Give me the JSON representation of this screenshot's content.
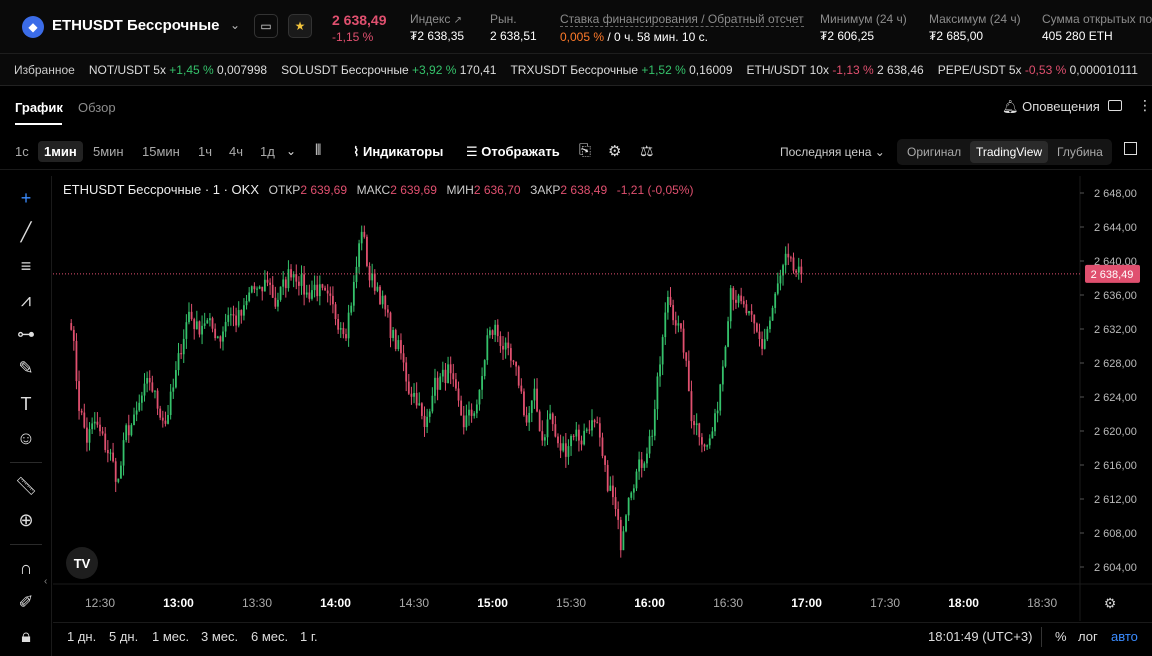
{
  "header": {
    "pair": "ETHUSDT Бессрочные",
    "last_price": "2 638,49",
    "change_pct": "-1,15 %",
    "stats": [
      {
        "label": "Индекс",
        "value": "₮2 638,35"
      },
      {
        "label": "Рын.",
        "value": "2 638,51"
      },
      {
        "label": "Ставка финансирования / Обратный отсчет",
        "value_rate": "0,005 %",
        "value_time": "/ 0 ч. 58 мин. 10 с."
      },
      {
        "label": "Минимум (24 ч)",
        "value": "₮2 606,25"
      },
      {
        "label": "Максимум (24 ч)",
        "value": "₮2 685,00"
      },
      {
        "label": "Сумма открытых поз",
        "value": "405 280 ETH"
      }
    ]
  },
  "favorites": {
    "label": "Избранное",
    "items": [
      {
        "name": "NOT/USDT 5x",
        "change": "+1,45 %",
        "price": "0,007998",
        "dir": "up"
      },
      {
        "name": "SOLUSDT Бессрочные",
        "change": "+3,92 %",
        "price": "170,41",
        "dir": "up"
      },
      {
        "name": "TRXUSDT Бессрочные",
        "change": "+1,52 %",
        "price": "0,16009",
        "dir": "up"
      },
      {
        "name": "ETH/USDT 10x",
        "change": "-1,13 %",
        "price": "2 638,46",
        "dir": "down"
      },
      {
        "name": "PEPE/USDT 5x",
        "change": "-0,53 %",
        "price": "0,000010111",
        "dir": "down"
      }
    ]
  },
  "tabs": {
    "chart": "График",
    "overview": "Обзор",
    "alerts": "Оповещения"
  },
  "toolbar": {
    "timeframes": [
      "1с",
      "1мин",
      "5мин",
      "15мин",
      "1ч",
      "4ч",
      "1д"
    ],
    "indicators": "Индикаторы",
    "display": "Отображать",
    "price_source": "Последняя цена",
    "views": [
      "Оригинал",
      "TradingView",
      "Глубина"
    ]
  },
  "legend": {
    "title": "ETHUSDT Бессрочные · 1 · OKX",
    "open_label": "ОТКР",
    "open": "2 639,69",
    "high_label": "МАКС",
    "high": "2 639,69",
    "low_label": "МИН",
    "low": "2 636,70",
    "close_label": "ЗАКР",
    "close": "2 638,49",
    "change": "-1,21 (-0,05%)"
  },
  "chart_data": {
    "type": "candlestick",
    "ylim": [
      2602,
      2650
    ],
    "y_ticks": [
      "2 648,00",
      "2 644,00",
      "2 640,00",
      "2 636,00",
      "2 632,00",
      "2 628,00",
      "2 624,00",
      "2 620,00",
      "2 616,00",
      "2 612,00",
      "2 608,00",
      "2 604,00"
    ],
    "y_tick_values": [
      2648,
      2644,
      2640,
      2636,
      2632,
      2628,
      2624,
      2620,
      2616,
      2612,
      2608,
      2604
    ],
    "x_ticks": [
      {
        "label": "12:30",
        "bold": false,
        "t": 0
      },
      {
        "label": "13:00",
        "bold": true,
        "t": 30
      },
      {
        "label": "13:30",
        "bold": false,
        "t": 60
      },
      {
        "label": "14:00",
        "bold": true,
        "t": 90
      },
      {
        "label": "14:30",
        "bold": false,
        "t": 120
      },
      {
        "label": "15:00",
        "bold": true,
        "t": 150
      },
      {
        "label": "15:30",
        "bold": false,
        "t": 180
      },
      {
        "label": "16:00",
        "bold": true,
        "t": 210
      },
      {
        "label": "16:30",
        "bold": false,
        "t": 240
      },
      {
        "label": "17:00",
        "bold": true,
        "t": 270
      },
      {
        "label": "17:30",
        "bold": false,
        "t": 300
      },
      {
        "label": "18:00",
        "bold": true,
        "t": 330
      },
      {
        "label": "18:30",
        "bold": false,
        "t": 360
      }
    ],
    "last_price": 2638.49,
    "last_price_label": "2 638,49",
    "waypoints": [
      [
        -11,
        2633
      ],
      [
        -8,
        2623
      ],
      [
        -5,
        2619
      ],
      [
        -2,
        2621
      ],
      [
        1,
        2619
      ],
      [
        4,
        2617
      ],
      [
        7,
        2614
      ],
      [
        10,
        2620
      ],
      [
        13,
        2621
      ],
      [
        16,
        2624
      ],
      [
        19,
        2626
      ],
      [
        22,
        2623
      ],
      [
        25,
        2621
      ],
      [
        28,
        2625
      ],
      [
        31,
        2630
      ],
      [
        34,
        2634
      ],
      [
        37,
        2632
      ],
      [
        40,
        2633
      ],
      [
        43,
        2632
      ],
      [
        46,
        2631
      ],
      [
        49,
        2634
      ],
      [
        52,
        2633
      ],
      [
        55,
        2634
      ],
      [
        58,
        2637
      ],
      [
        61,
        2636
      ],
      [
        64,
        2638
      ],
      [
        67,
        2635
      ],
      [
        70,
        2637
      ],
      [
        73,
        2639
      ],
      [
        76,
        2638
      ],
      [
        79,
        2636
      ],
      [
        82,
        2637
      ],
      [
        85,
        2636
      ],
      [
        88,
        2635
      ],
      [
        91,
        2633
      ],
      [
        94,
        2632
      ],
      [
        97,
        2637
      ],
      [
        100,
        2644
      ],
      [
        103,
        2638
      ],
      [
        106,
        2637
      ],
      [
        109,
        2634
      ],
      [
        112,
        2631
      ],
      [
        115,
        2629
      ],
      [
        118,
        2625
      ],
      [
        121,
        2624
      ],
      [
        124,
        2620
      ],
      [
        127,
        2625
      ],
      [
        130,
        2626
      ],
      [
        133,
        2627
      ],
      [
        136,
        2624
      ],
      [
        139,
        2621
      ],
      [
        142,
        2622
      ],
      [
        145,
        2624
      ],
      [
        148,
        2631
      ],
      [
        151,
        2632
      ],
      [
        154,
        2630
      ],
      [
        157,
        2628
      ],
      [
        160,
        2626
      ],
      [
        163,
        2621
      ],
      [
        166,
        2624
      ],
      [
        169,
        2619
      ],
      [
        172,
        2622
      ],
      [
        175,
        2618
      ],
      [
        178,
        2618
      ],
      [
        181,
        2620
      ],
      [
        184,
        2619
      ],
      [
        187,
        2621
      ],
      [
        190,
        2620
      ],
      [
        193,
        2615
      ],
      [
        196,
        2612
      ],
      [
        199,
        2607
      ],
      [
        202,
        2613
      ],
      [
        205,
        2615
      ],
      [
        208,
        2617
      ],
      [
        211,
        2620
      ],
      [
        214,
        2628
      ],
      [
        217,
        2636
      ],
      [
        220,
        2633
      ],
      [
        223,
        2630
      ],
      [
        226,
        2622
      ],
      [
        229,
        2620
      ],
      [
        232,
        2618
      ],
      [
        235,
        2621
      ],
      [
        238,
        2628
      ],
      [
        241,
        2637
      ],
      [
        244,
        2635
      ],
      [
        247,
        2634
      ],
      [
        250,
        2632
      ],
      [
        253,
        2630
      ],
      [
        256,
        2633
      ],
      [
        259,
        2637
      ],
      [
        262,
        2640
      ],
      [
        265,
        2639
      ],
      [
        268,
        2638
      ]
    ]
  },
  "bottom": {
    "ranges": [
      "1 дн.",
      "5 дн.",
      "1 мес.",
      "3 мес.",
      "6 мес.",
      "1 г."
    ],
    "clock": "18:01:49 (UTC+3)",
    "pct": "%",
    "log": "лог",
    "auto": "авто"
  }
}
